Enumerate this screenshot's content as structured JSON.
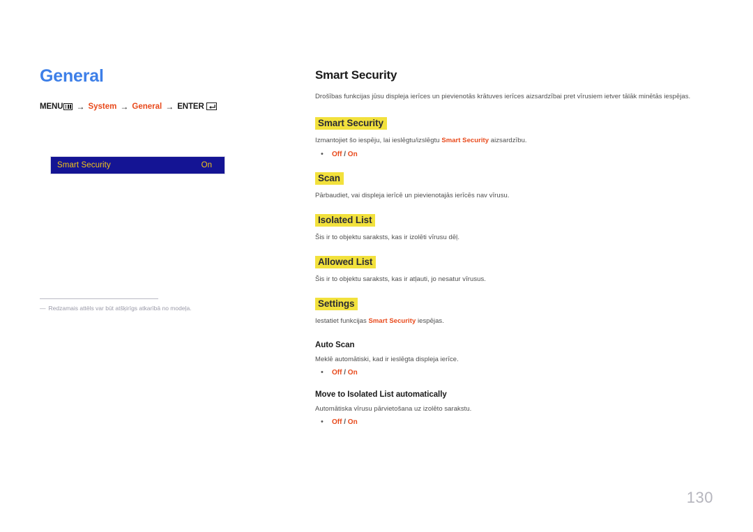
{
  "page": {
    "number": "130",
    "title": "General"
  },
  "breadcrumb": {
    "menu_label": "MENU",
    "menu_icon": "menu-grid-icon",
    "arrow": "→",
    "item1": "System",
    "item2": "General",
    "enter_label": "ENTER",
    "enter_icon": "enter-return-icon"
  },
  "osd": {
    "label": "Smart Security",
    "value": "On"
  },
  "footnote": {
    "dash": "―",
    "text": "Redzamais attēls var būt atšķirīgs atkarībā no modeļa."
  },
  "main": {
    "section_title": "Smart Security",
    "intro": "Drošības funkcijas jūsu displeja ierīces un pievienotās krātuves ierīces aizsardzībai pret vīrusiem ietver tālāk minētās iespējas.",
    "blocks": [
      {
        "heading": "Smart Security",
        "heading_style": "highlight",
        "desc_before": "Izmantojiet šo iespēju, lai ieslēgtu/izslēgtu ",
        "desc_emphasis": "Smart Security",
        "desc_after": " aizsardzību.",
        "bullet_off": "Off",
        "bullet_sep": " / ",
        "bullet_on": "On"
      },
      {
        "heading": "Scan",
        "heading_style": "highlight",
        "desc_before": "Pārbaudiet, vai displeja ierīcē un pievienotajās ierīcēs nav vīrusu.",
        "desc_emphasis": "",
        "desc_after": ""
      },
      {
        "heading": "Isolated List",
        "heading_style": "highlight",
        "desc_before": "Šis ir to objektu saraksts, kas ir izolēti vīrusu dēļ.",
        "desc_emphasis": "",
        "desc_after": ""
      },
      {
        "heading": "Allowed List",
        "heading_style": "highlight",
        "desc_before": "Šis ir to objektu saraksts, kas ir atļauti, jo nesatur vīrusus.",
        "desc_emphasis": "",
        "desc_after": ""
      },
      {
        "heading": "Settings",
        "heading_style": "highlight",
        "desc_before": "Iestatiet funkcijas ",
        "desc_emphasis": "Smart Security",
        "desc_after": " iespējas."
      },
      {
        "heading": "Auto Scan",
        "heading_style": "plain",
        "desc_before": "Meklē automātiski, kad ir ieslēgta displeja ierīce.",
        "desc_emphasis": "",
        "desc_after": "",
        "bullet_off": "Off",
        "bullet_sep": " / ",
        "bullet_on": "On"
      },
      {
        "heading": "Move to Isolated List automatically",
        "heading_style": "plain",
        "desc_before": "Automātiska vīrusu pārvietošana uz izolēto sarakstu.",
        "desc_emphasis": "",
        "desc_after": "",
        "bullet_off": "Off",
        "bullet_sep": " / ",
        "bullet_on": "On"
      }
    ]
  },
  "colors": {
    "title_blue": "#3d7fe8",
    "accent_red": "#e8491b",
    "highlight_yellow": "#f2e13c",
    "osd_bg": "#141494",
    "osd_text": "#f5c518",
    "page_number": "#b5b5bd"
  }
}
